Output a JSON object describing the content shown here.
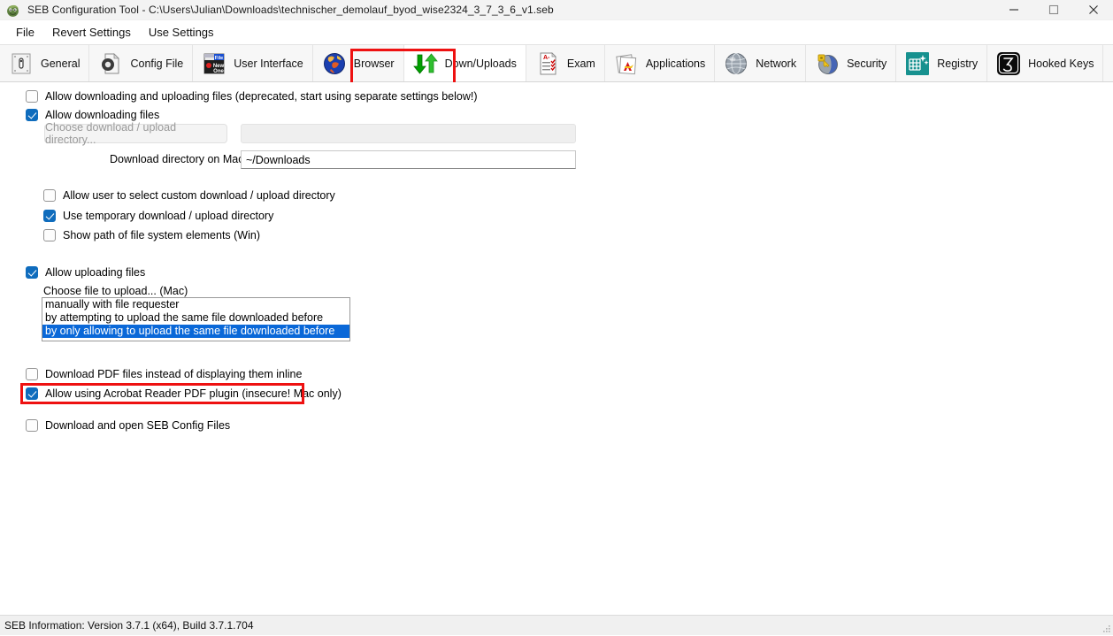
{
  "window": {
    "title": "SEB Configuration Tool - C:\\Users\\Julian\\Downloads\\technischer_demolauf_byod_wise2324_3_7_3_6_v1.seb",
    "app_icon": "seb-app-icon",
    "controls": {
      "minimize": "minimize-icon",
      "maximize": "maximize-icon",
      "close": "close-icon"
    }
  },
  "menu": {
    "items": [
      {
        "label": "File"
      },
      {
        "label": "Revert Settings"
      },
      {
        "label": "Use Settings"
      }
    ]
  },
  "toolbar": {
    "tabs": [
      {
        "label": "General",
        "icon": "general-icon",
        "active": false
      },
      {
        "label": "Config File",
        "icon": "config-file-icon",
        "active": false
      },
      {
        "label": "User Interface",
        "icon": "user-interface-icon",
        "active": false
      },
      {
        "label": "Browser",
        "icon": "browser-globe-icon",
        "active": false
      },
      {
        "label": "Down/Uploads",
        "icon": "down-uploads-icon",
        "active": true
      },
      {
        "label": "Exam",
        "icon": "exam-icon",
        "active": false
      },
      {
        "label": "Applications",
        "icon": "applications-icon",
        "active": false
      },
      {
        "label": "Network",
        "icon": "network-globe-icon",
        "active": false
      },
      {
        "label": "Security",
        "icon": "security-key-icon",
        "active": false
      },
      {
        "label": "Registry",
        "icon": "registry-icon",
        "active": false
      },
      {
        "label": "Hooked Keys",
        "icon": "hooked-keys-icon",
        "active": false
      }
    ]
  },
  "panel": {
    "allow_down_upload": {
      "label": "Allow downloading and uploading files (deprecated, start using separate settings below!)",
      "checked": false
    },
    "allow_downloading": {
      "label": "Allow downloading files",
      "checked": true
    },
    "choose_directory_button": {
      "label": "Choose download / upload directory...",
      "enabled": false
    },
    "directory_value_field": {
      "value": "",
      "enabled": false
    },
    "download_directory_mac": {
      "label": "Download directory on Mac",
      "value": "~/Downloads"
    },
    "allow_custom_directory": {
      "label": "Allow user to select custom download / upload directory",
      "checked": false
    },
    "use_temp_directory": {
      "label": "Use temporary download / upload directory",
      "checked": true
    },
    "show_path_elements": {
      "label": "Show path of file system elements (Win)",
      "checked": false
    },
    "allow_uploading": {
      "label": "Allow uploading files",
      "checked": true
    },
    "choose_file_label": "Choose file to upload... (Mac)",
    "upload_options": [
      {
        "label": "manually with file requester",
        "selected": false
      },
      {
        "label": "by attempting to upload the same file downloaded before",
        "selected": false
      },
      {
        "label": "by only allowing to upload the same file downloaded before",
        "selected": true
      }
    ],
    "download_pdf_inline": {
      "label": "Download PDF files instead of displaying them inline",
      "checked": false
    },
    "acrobat_plugin": {
      "label": "Allow using Acrobat Reader PDF plugin (insecure! Mac only)",
      "checked": true,
      "highlighted": true
    },
    "download_open_seb_config": {
      "label": "Download and open SEB Config Files",
      "checked": false
    }
  },
  "statusbar": {
    "text": "SEB Information: Version 3.7.1 (x64), Build 3.7.1.704"
  },
  "colors": {
    "highlight_red": "#ee1111",
    "checkbox_blue": "#0f6cbd",
    "selection_blue": "#0a68d8",
    "registry_teal": "#17918f"
  }
}
